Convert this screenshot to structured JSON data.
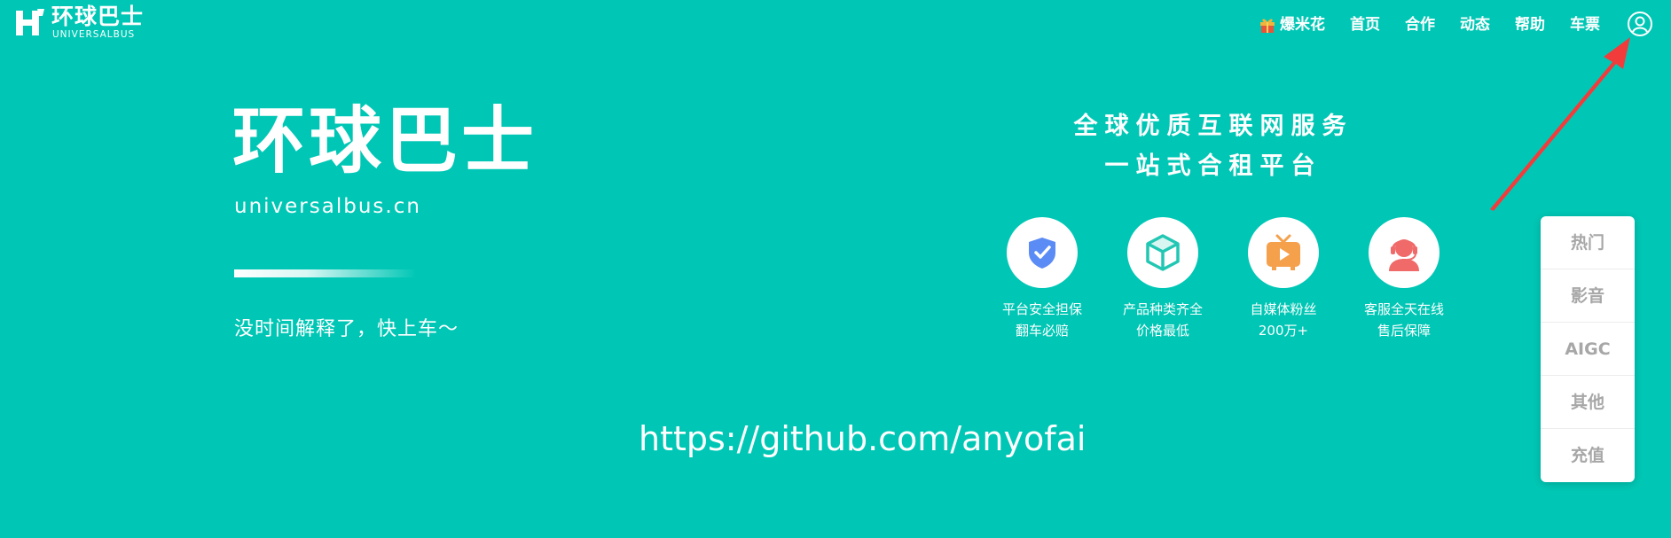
{
  "header": {
    "logo": {
      "cn": "环球巴士",
      "en": "UNIVERSALBUS"
    },
    "nav": [
      {
        "label": "爆米花",
        "icon": "gift-icon"
      },
      {
        "label": "首页"
      },
      {
        "label": "合作"
      },
      {
        "label": "动态"
      },
      {
        "label": "帮助"
      },
      {
        "label": "车票"
      }
    ],
    "user_icon": "user-circle-icon"
  },
  "hero": {
    "title": "环球巴士",
    "domain": "universalbus.cn",
    "slogan": "没时间解释了，快上车～"
  },
  "promo": {
    "line1": "全球优质互联网服务",
    "line2": "一站式合租平台",
    "features": [
      {
        "icon": "shield-check-icon",
        "color": "#5b8cf5",
        "line1": "平台安全担保",
        "line2": "翻车必赔"
      },
      {
        "icon": "cube-icon",
        "color": "#22c7b4",
        "line1": "产品种类齐全",
        "line2": "价格最低"
      },
      {
        "icon": "tv-play-icon",
        "color": "#f5a04b",
        "line1": "自媒体粉丝",
        "line2": "200万+"
      },
      {
        "icon": "customer-service-icon",
        "color": "#f06a6a",
        "line1": "客服全天在线",
        "line2": "售后保障"
      }
    ]
  },
  "center_url": "https://github.com/anyofai",
  "side_panel": {
    "items": [
      "热门",
      "影音",
      "AIGC",
      "其他",
      "充值"
    ]
  },
  "colors": {
    "background": "#00c7b5",
    "panel_text": "#a7a7a7",
    "arrow": "#f23c3c"
  }
}
